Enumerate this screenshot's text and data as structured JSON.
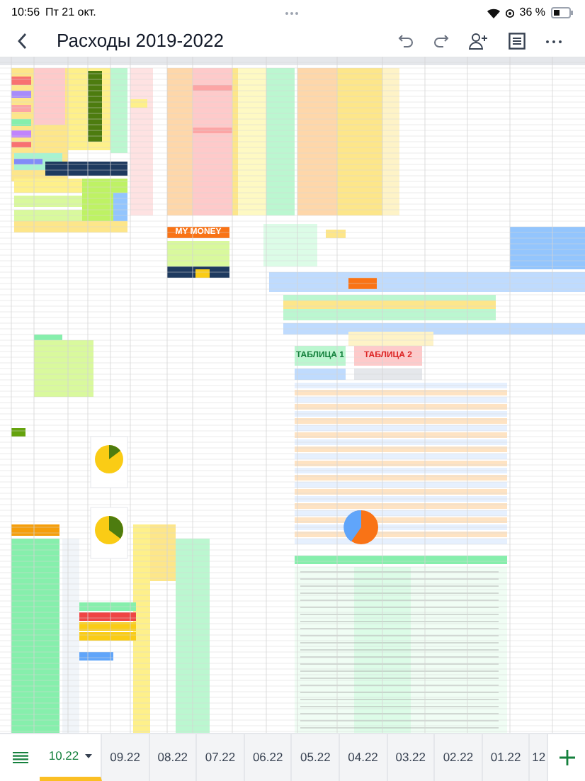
{
  "status_bar": {
    "time": "10:56",
    "date": "Пт 21 окт.",
    "battery": "36 %"
  },
  "toolbar": {
    "title": "Расходы 2019-2022"
  },
  "sheet": {
    "labels": [
      {
        "kind": "money",
        "text": "MY MONEY"
      },
      {
        "kind": "table1",
        "text": "ТАБЛИЦА 1"
      },
      {
        "kind": "table2",
        "text": "ТАБЛИЦА 2"
      }
    ]
  },
  "tabs": [
    {
      "label": "10.22",
      "selected": true
    },
    {
      "label": "09.22",
      "selected": false
    },
    {
      "label": "08.22",
      "selected": false
    },
    {
      "label": "07.22",
      "selected": false
    },
    {
      "label": "06.22",
      "selected": false
    },
    {
      "label": "05.22",
      "selected": false
    },
    {
      "label": "04.22",
      "selected": false
    },
    {
      "label": "03.22",
      "selected": false
    },
    {
      "label": "02.22",
      "selected": false
    },
    {
      "label": "01.22",
      "selected": false
    },
    {
      "label": "12",
      "selected": false
    }
  ]
}
